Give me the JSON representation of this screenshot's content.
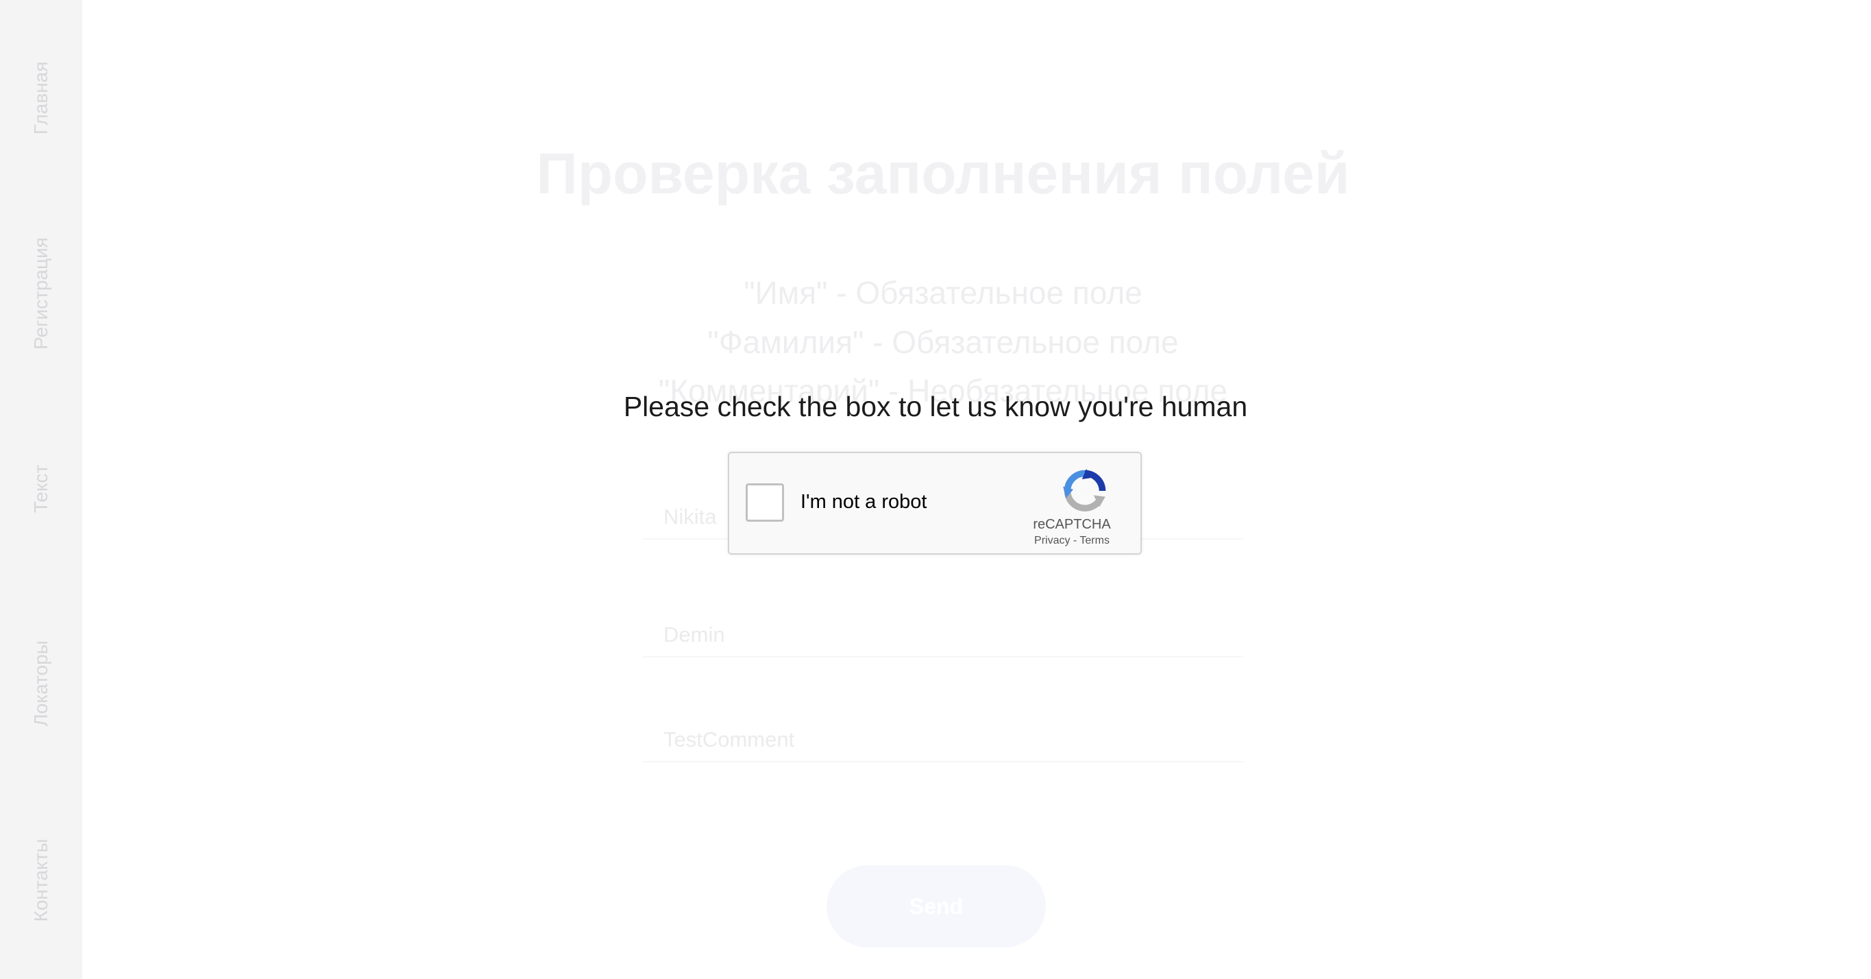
{
  "nav": {
    "items": [
      {
        "label": "Главная"
      },
      {
        "label": "Регистрация"
      },
      {
        "label": "Текст"
      },
      {
        "label": "Локаторы"
      },
      {
        "label": "Контакты"
      }
    ]
  },
  "main": {
    "title": "Проверка заполнения полей",
    "requirements": [
      "\"Имя\" - Обязательное поле",
      "\"Фамилия\" - Обязательное поле",
      "\"Комментарий\" - Необязательное поле"
    ],
    "fields": {
      "first_name": "Nikita",
      "last_name": "Demin",
      "comment": "TestComment"
    },
    "send_label": "Send"
  },
  "captcha": {
    "prompt": "Please check the box to let us know you're human",
    "checkbox_label": "I'm not a robot",
    "checked": false,
    "brand": "reCAPTCHA",
    "privacy_label": "Privacy",
    "separator": "-",
    "terms_label": "Terms",
    "logo_icon": "recaptcha-logo-icon",
    "colors": {
      "logo_blue": "#1c3aa9",
      "logo_light_blue": "#4a90e2",
      "logo_grey": "#b1b1b1"
    }
  }
}
